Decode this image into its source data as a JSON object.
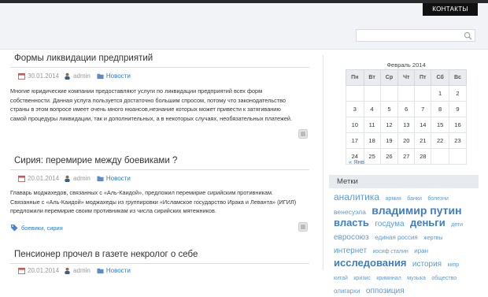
{
  "header": {
    "contacts_label": "КОНТАКТЫ",
    "search": {
      "value": "",
      "placeholder": ""
    }
  },
  "posts": [
    {
      "title": "Формы ликвидации предприятий",
      "date": "30.01.2014",
      "author": "admin",
      "category": "Новости",
      "excerpt": [
        "Многие юридические компании предоставляют услуги по ликвидации предприятий всех форм",
        "собственности. Данная услуга пользуется достаточно большим спросом, потому что законодательство",
        "страны в этом вопросе имеет очень много нюансов,незнание которых может привести к затягиванию",
        "самой процедуры ликвидации, так и дополнительных, а в некоторых случаях, необязательных платежей."
      ]
    },
    {
      "title": "Сирия: перемирие между боевиками ?",
      "date": "20.01.2014",
      "author": "admin",
      "category": "Новости",
      "excerpt": [
        "Главарь моджахедов, связанных с «Аль-Каидой», предложил перемирие сирийским противникам.",
        "Связанные с «Аль-Каидой» моджахеды из группировки «Исламское государство Ирака и Леванта» (ИГИЛ)",
        "предложили перемирие своим противникам из числа сирийских мятежников."
      ],
      "tags": "боевики, сирия"
    },
    {
      "title": "Пенсионер прочел в газете некролог о себе",
      "date": "20.01.2014",
      "author": "admin",
      "category": "Новости"
    }
  ],
  "calendar": {
    "caption": "Февраль 2014",
    "weekdays": [
      "Пн",
      "Вт",
      "Ср",
      "Чт",
      "Пт",
      "Сб",
      "Вс"
    ],
    "weeks": [
      [
        "",
        "",
        "",
        "",
        "",
        "1",
        "2"
      ],
      [
        "3",
        "4",
        "5",
        "6",
        "7",
        "8",
        "9"
      ],
      [
        "10",
        "11",
        "12",
        "13",
        "14",
        "15",
        "16"
      ],
      [
        "17",
        "18",
        "19",
        "20",
        "21",
        "22",
        "23"
      ],
      [
        "24",
        "25",
        "26",
        "27",
        "28",
        "",
        ""
      ]
    ],
    "prev_link": "« Янв"
  },
  "tags_widget": {
    "title": "Метки",
    "cloud": [
      {
        "t": "аналитика",
        "s": 12
      },
      {
        "t": "армия",
        "s": 7
      },
      {
        "t": "банки",
        "s": 7
      },
      {
        "t": "болезни",
        "s": 7
      },
      {
        "t": "венесуэла",
        "s": 8.5
      },
      {
        "t": "владимир путин",
        "s": 14,
        "b": true
      },
      {
        "t": "власть",
        "s": 13,
        "b": true
      },
      {
        "t": "госдума",
        "s": 10
      },
      {
        "t": "деньги",
        "s": 13,
        "b": true
      },
      {
        "t": "дети",
        "s": 7
      },
      {
        "t": "евросоюз",
        "s": 10
      },
      {
        "t": "единая россия",
        "s": 8
      },
      {
        "t": "жертвы",
        "s": 7
      },
      {
        "t": "интернет",
        "s": 10
      },
      {
        "t": "иосиф сталин",
        "s": 7
      },
      {
        "t": "иран",
        "s": 8
      },
      {
        "t": "исследования",
        "s": 13,
        "b": true
      },
      {
        "t": "история",
        "s": 10
      },
      {
        "t": "кипр",
        "s": 7
      },
      {
        "t": "китай",
        "s": 7
      },
      {
        "t": "кризис",
        "s": 7
      },
      {
        "t": "криминал",
        "s": 7
      },
      {
        "t": "музыка",
        "s": 7
      },
      {
        "t": "общество",
        "s": 7
      },
      {
        "t": "олигархи",
        "s": 8
      },
      {
        "t": "оппозиция",
        "s": 10
      }
    ]
  }
}
